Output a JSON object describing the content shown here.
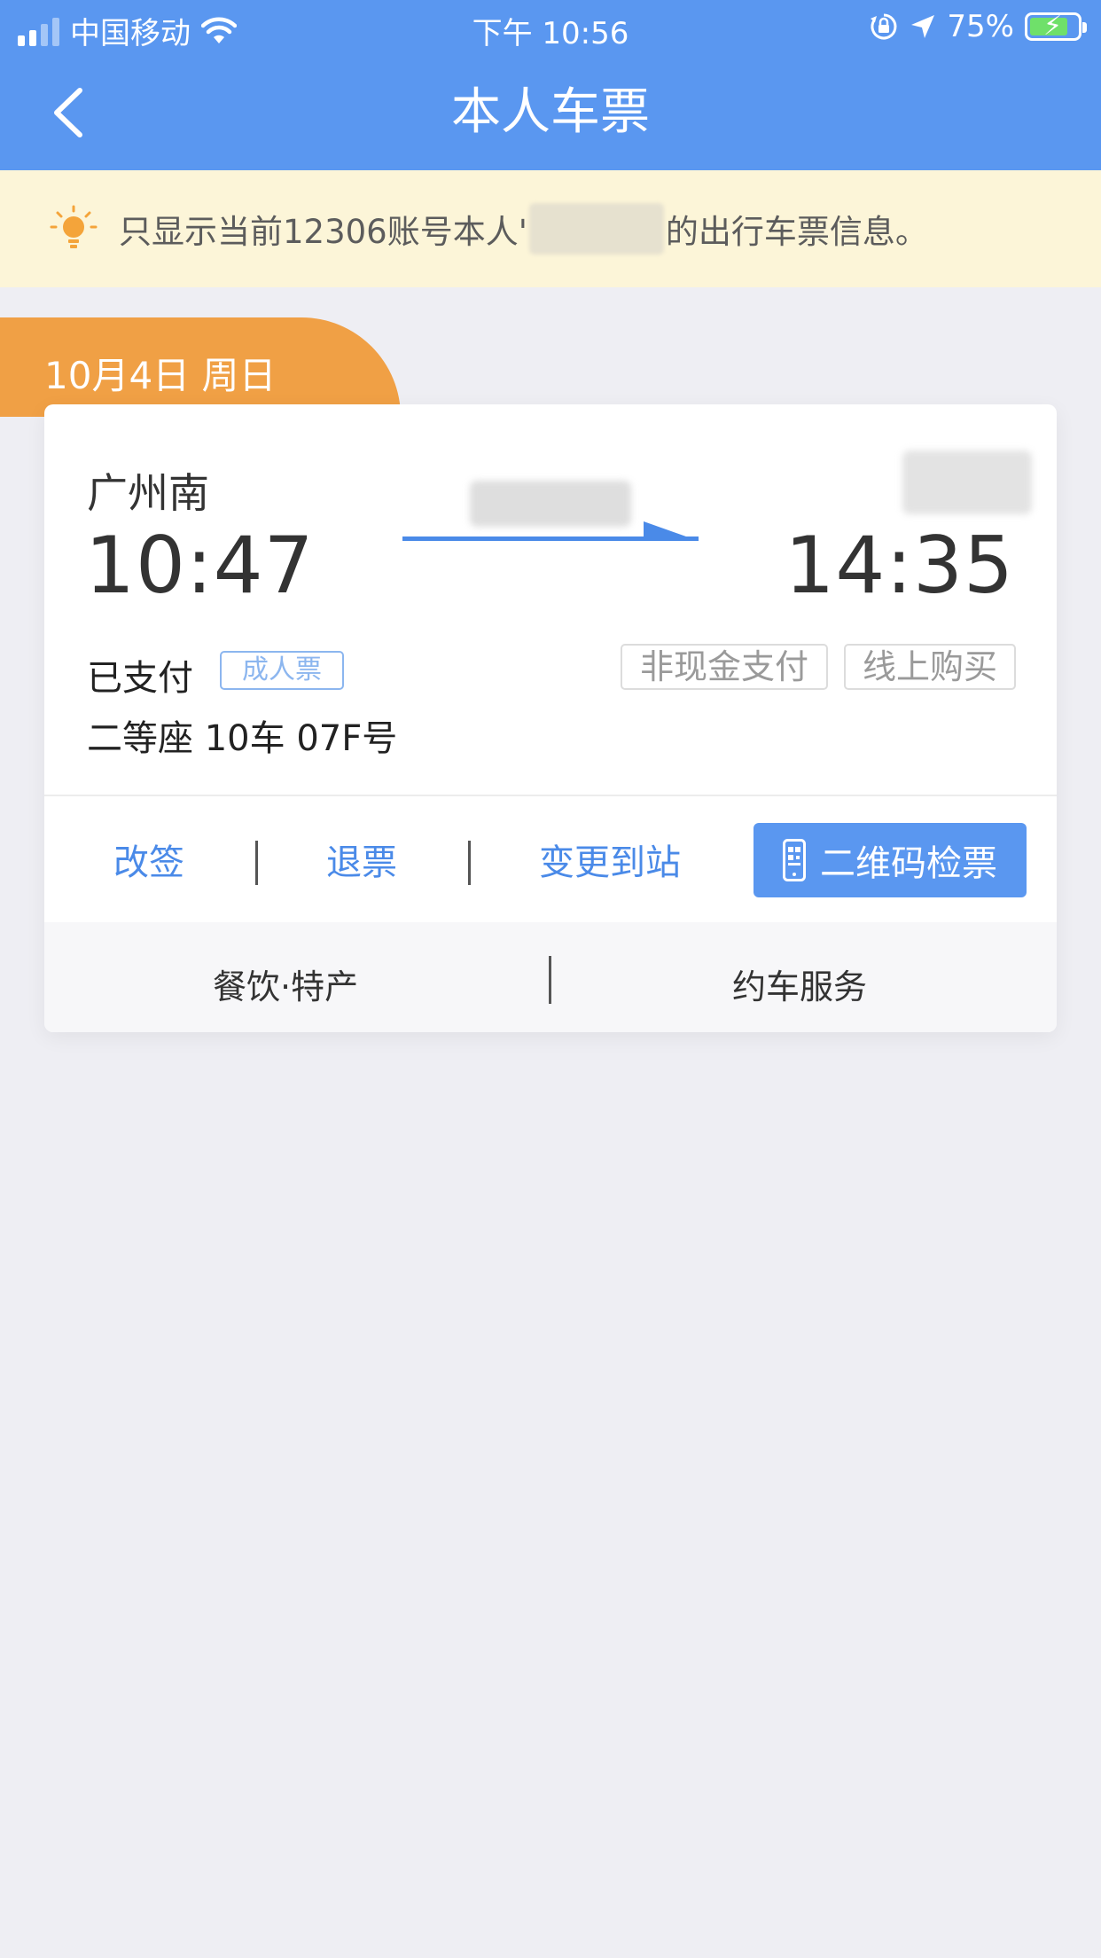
{
  "status_bar": {
    "carrier": "中国移动",
    "time": "下午 10:56",
    "battery_percent": "75%",
    "icons": [
      "signal-icon",
      "wifi-icon",
      "rotation-lock-icon",
      "location-icon",
      "battery-charging-icon"
    ]
  },
  "nav": {
    "title": "本人车票",
    "back_icon": "chevron-left-icon"
  },
  "notice": {
    "icon": "lightbulb-icon",
    "text_before": "只显示当前12306账号本人'",
    "text_after": "的出行车票信息。"
  },
  "ticket": {
    "date": "10月4日 周日",
    "from_station": "广州南",
    "departure_time": "10:47",
    "arrival_time": "14:35",
    "payment_status": "已支付",
    "ticket_type": "成人票",
    "payment_method": "非现金支付",
    "purchase_channel": "线上购买",
    "seat": "二等座 10车 07F号",
    "actions": {
      "change": "改签",
      "refund": "退票",
      "change_destination": "变更到站",
      "qr_check": "二维码检票"
    },
    "services": {
      "catering": "餐饮·特产",
      "ride": "约车服务"
    }
  },
  "colors": {
    "header": "#5a97f0",
    "notice_bg": "#fcf5d8",
    "date_tab": "#f0a045",
    "link": "#4a8ae8",
    "page_bg": "#eeeef3"
  }
}
